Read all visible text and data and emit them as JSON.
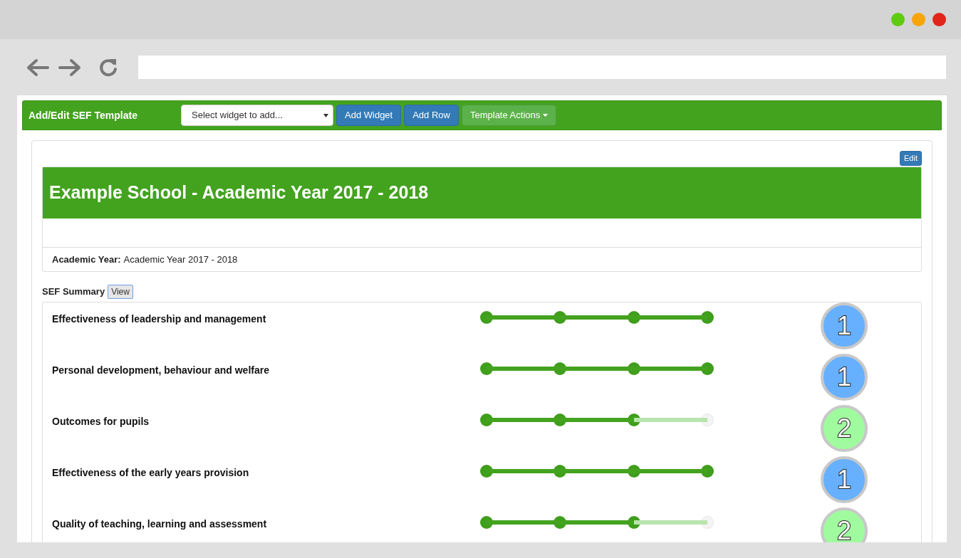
{
  "toolbar": {
    "title": "Add/Edit SEF Template",
    "widget_select": {
      "placeholder": "Select widget to add..."
    },
    "buttons": [
      {
        "label": "Add Widget",
        "kind": "primary"
      },
      {
        "label": "Add Row",
        "kind": "primary"
      },
      {
        "label": "Template Actions",
        "kind": "dropdown"
      }
    ]
  },
  "edit_button": "Edit",
  "banner": {
    "title": "Example School - Academic Year 2017 - 2018"
  },
  "academic_year": {
    "label": "Academic Year:",
    "value": "Academic Year 2017 - 2018"
  },
  "summary": {
    "title": "SEF Summary",
    "view_button": "View"
  },
  "areas": [
    {
      "name": "Effectiveness of leadership and management",
      "level": 1,
      "grade": "1",
      "color": "#66b0ff"
    },
    {
      "name": "Personal development, behaviour and welfare",
      "level": 1,
      "grade": "1",
      "color": "#66b0ff"
    },
    {
      "name": "Outcomes for pupils",
      "level": 0.667,
      "grade": "2",
      "color": "#a0fb9f"
    },
    {
      "name": "Effectiveness of the early years provision",
      "level": 1,
      "grade": "1",
      "color": "#66b0ff"
    },
    {
      "name": "Quality of teaching, learning and assessment",
      "level": 0.667,
      "grade": "2",
      "color": "#a0fb9f"
    }
  ]
}
